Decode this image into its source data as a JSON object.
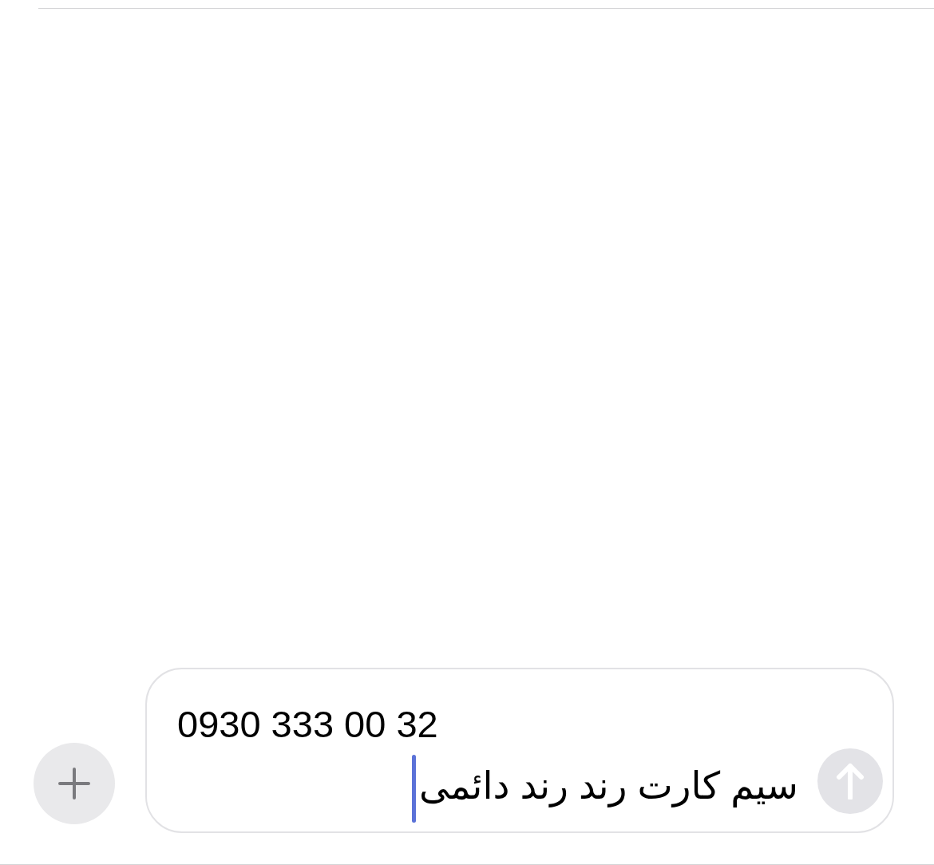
{
  "composer": {
    "lines": [
      {
        "text": "0930 333 00 32",
        "kind": "number"
      },
      {
        "text": "سیم کارت رند رند دائمی",
        "kind": "persian"
      }
    ],
    "focused": true,
    "send_disabled": true
  }
}
